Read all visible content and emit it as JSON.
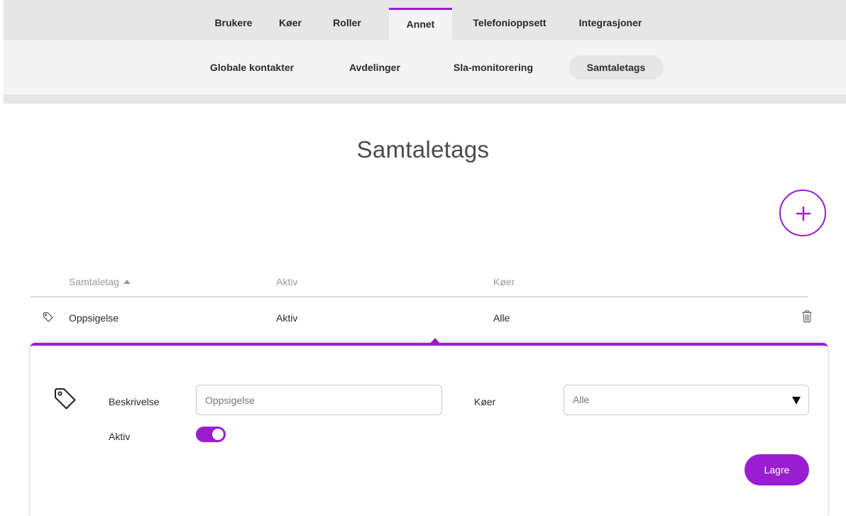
{
  "top_tabs": [
    {
      "label": "Brukere"
    },
    {
      "label": "Køer"
    },
    {
      "label": "Roller"
    },
    {
      "label": "Annet",
      "active": true
    },
    {
      "label": "Telefonioppsett"
    },
    {
      "label": "Integrasjoner"
    }
  ],
  "sub_tabs": [
    {
      "label": "Globale kontakter"
    },
    {
      "label": "Avdelinger"
    },
    {
      "label": "Sla-monitorering"
    },
    {
      "label": "Samtaletags",
      "active": true
    }
  ],
  "page_title": "Samtaletags",
  "add_button": {
    "icon": "plus-icon"
  },
  "table": {
    "headers": {
      "tag": "Samtaletag",
      "active": "Aktiv",
      "queues": "Køer"
    },
    "sort": {
      "column": "tag",
      "direction": "ascending",
      "icon": "sort-up-icon"
    },
    "rows": [
      {
        "icon": "tag-icon",
        "tag": "Oppsigelse",
        "active": "Aktiv",
        "queues": "Alle",
        "action_icon": "trash-icon"
      }
    ]
  },
  "edit_panel": {
    "icon": "tag-icon",
    "description_label": "Beskrivelse",
    "description_value": "Oppsigelse",
    "queues_label": "Køer",
    "queues_value": "Alle",
    "active_label": "Aktiv",
    "active_on": true,
    "save_label": "Lagre"
  },
  "colors": {
    "accent": "#9b1dd1",
    "top_nav_bg": "#e6e6e6",
    "sub_nav_bg": "#f4f4f4"
  }
}
